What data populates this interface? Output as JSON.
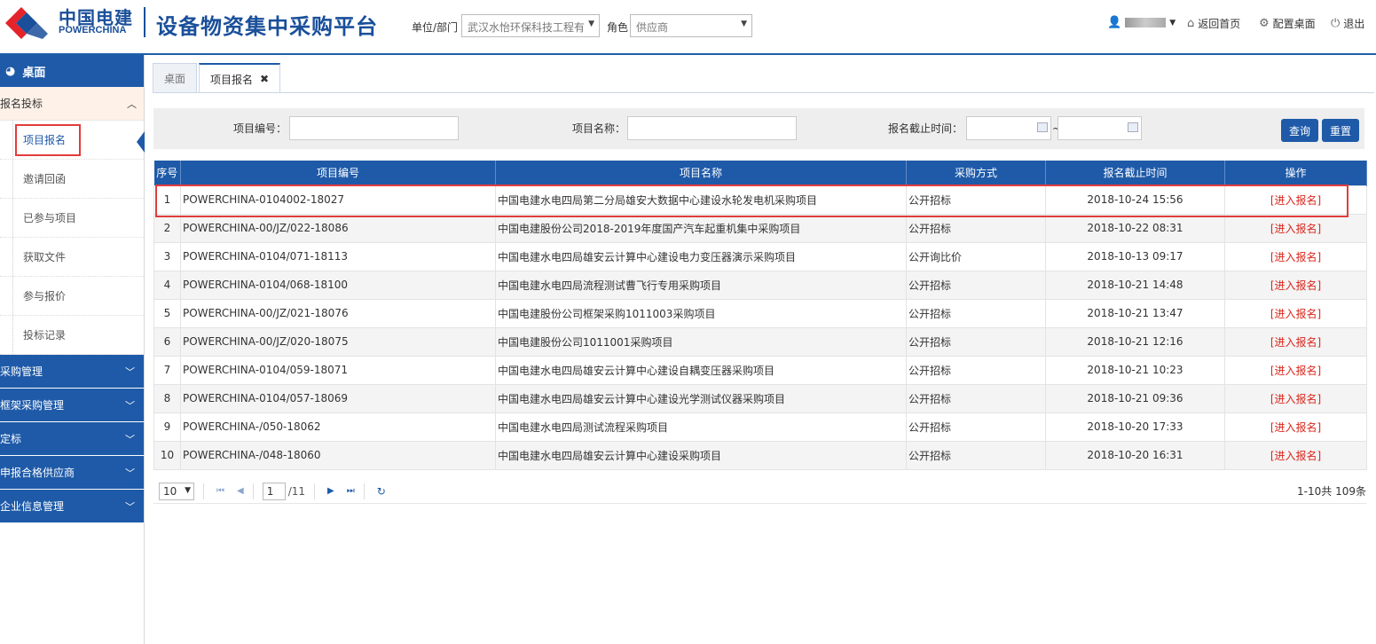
{
  "header": {
    "logo_cn": "中国电建",
    "logo_en": "POWERCHINA",
    "title": "设备物资集中采购平台",
    "unit_label": "单位/部门",
    "unit_value": "武汉水怡环保科技工程有",
    "role_label": "角色",
    "role_value": "供应商",
    "home_link": "返回首页",
    "config_link": "配置桌面",
    "logout_link": "退出"
  },
  "sidebar": {
    "desk": "桌面",
    "open_group": "报名投标",
    "sub_items": [
      "项目报名",
      "邀请回函",
      "已参与项目",
      "获取文件",
      "参与报价",
      "投标记录"
    ],
    "groups": [
      "采购管理",
      "框架采购管理",
      "定标",
      "申报合格供应商",
      "企业信息管理"
    ]
  },
  "tabs": {
    "desk": "桌面",
    "current": "项目报名"
  },
  "search": {
    "code_label": "项目编号：",
    "name_label": "项目名称：",
    "deadline_label": "报名截止时间：",
    "range_sep": "~",
    "query_button": "查询",
    "reset_button": "重置"
  },
  "table": {
    "headers": [
      "序号",
      "项目编号",
      "项目名称",
      "采购方式",
      "报名截止时间",
      "操作"
    ],
    "action_label": "[进入报名]",
    "rows": [
      {
        "no": "1",
        "code": "POWERCHINA-0104002-18027",
        "name": "中国电建水电四局第二分局雄安大数据中心建设水轮发电机采购项目",
        "method": "公开招标",
        "deadline": "2018-10-24 15:56"
      },
      {
        "no": "2",
        "code": "POWERCHINA-00/JZ/022-18086",
        "name": "中国电建股份公司2018-2019年度国产汽车起重机集中采购项目",
        "method": "公开招标",
        "deadline": "2018-10-22 08:31"
      },
      {
        "no": "3",
        "code": "POWERCHINA-0104/071-18113",
        "name": "中国电建水电四局雄安云计算中心建设电力变压器演示采购项目",
        "method": "公开询比价",
        "deadline": "2018-10-13 09:17"
      },
      {
        "no": "4",
        "code": "POWERCHINA-0104/068-18100",
        "name": "中国电建水电四局流程测试曹飞行专用采购项目",
        "method": "公开招标",
        "deadline": "2018-10-21 14:48"
      },
      {
        "no": "5",
        "code": "POWERCHINA-00/JZ/021-18076",
        "name": "中国电建股份公司框架采购1011003采购项目",
        "method": "公开招标",
        "deadline": "2018-10-21 13:47"
      },
      {
        "no": "6",
        "code": "POWERCHINA-00/JZ/020-18075",
        "name": "中国电建股份公司1011001采购项目",
        "method": "公开招标",
        "deadline": "2018-10-21 12:16"
      },
      {
        "no": "7",
        "code": "POWERCHINA-0104/059-18071",
        "name": "中国电建水电四局雄安云计算中心建设自耦变压器采购项目",
        "method": "公开招标",
        "deadline": "2018-10-21 10:23"
      },
      {
        "no": "8",
        "code": "POWERCHINA-0104/057-18069",
        "name": "中国电建水电四局雄安云计算中心建设光学测试仪器采购项目",
        "method": "公开招标",
        "deadline": "2018-10-21 09:36"
      },
      {
        "no": "9",
        "code": "POWERCHINA-/050-18062",
        "name": "中国电建水电四局测试流程采购项目",
        "method": "公开招标",
        "deadline": "2018-10-20 17:33"
      },
      {
        "no": "10",
        "code": "POWERCHINA-/048-18060",
        "name": "中国电建水电四局雄安云计算中心建设采购项目",
        "method": "公开招标",
        "deadline": "2018-10-20 16:31"
      }
    ]
  },
  "pager": {
    "page_size": "10",
    "page": "1",
    "total_pages": "/11",
    "info": "1-10共 109条"
  }
}
